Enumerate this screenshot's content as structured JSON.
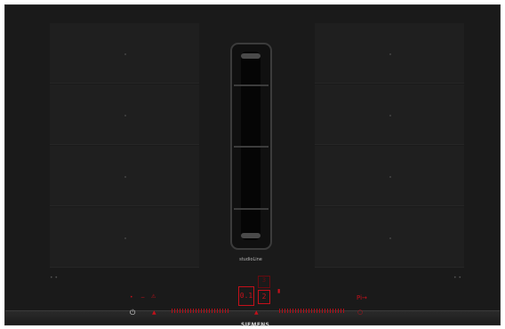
{
  "brand": {
    "series": "studioLine",
    "logo": "SIEMENS"
  },
  "left_area": {
    "zones": 4,
    "corner_marks": "• •"
  },
  "right_area": {
    "zones": 4,
    "corner_marks": "• •"
  },
  "controls": {
    "power_icon": "power-icon",
    "timer_icon": "timer-icon",
    "left_indicators": [
      "•",
      "−",
      "⚠"
    ],
    "left_arrow": "▲",
    "center_arrow": "▲",
    "center_display": "0.1",
    "center_display_right": "2",
    "center_display_dim": "3",
    "fan_marker": "▮",
    "right_label": "Pi→",
    "timer_glyph": "○"
  },
  "colors": {
    "accent_red": "#c4101a",
    "surface": "#1a1a1a"
  }
}
